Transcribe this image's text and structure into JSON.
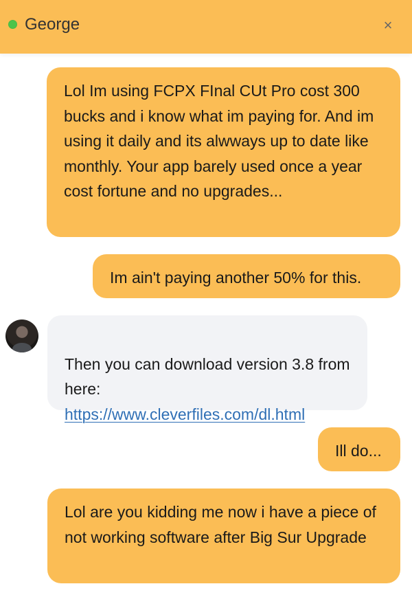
{
  "header": {
    "contact_name": "George",
    "status_color": "#4cc44a",
    "close_icon": "×",
    "background": "#fbbd55"
  },
  "messages": [
    {
      "direction": "outgoing",
      "text": "Lol Im using FCPX FInal CUt Pro cost 300 bucks and i know what im paying for. And im using it daily and its alwways up to date like monthly. Your app barely used once a year cost fortune and no upgrades..."
    },
    {
      "direction": "outgoing",
      "text": "Im ain't paying another 50% for this."
    },
    {
      "direction": "incoming",
      "text": "Then you can download version 3.8 from here:",
      "link": "https://www.cleverfiles.com/dl.html",
      "avatar_icon": "user-avatar"
    },
    {
      "direction": "outgoing",
      "text": "Ill do..."
    },
    {
      "direction": "outgoing",
      "text": "Lol are you kidding me now i have a piece of not working software after Big Sur Upgrade"
    }
  ],
  "colors": {
    "outgoing_bubble": "#fbbd55",
    "incoming_bubble": "#f2f3f6",
    "link": "#2f6fb5"
  }
}
